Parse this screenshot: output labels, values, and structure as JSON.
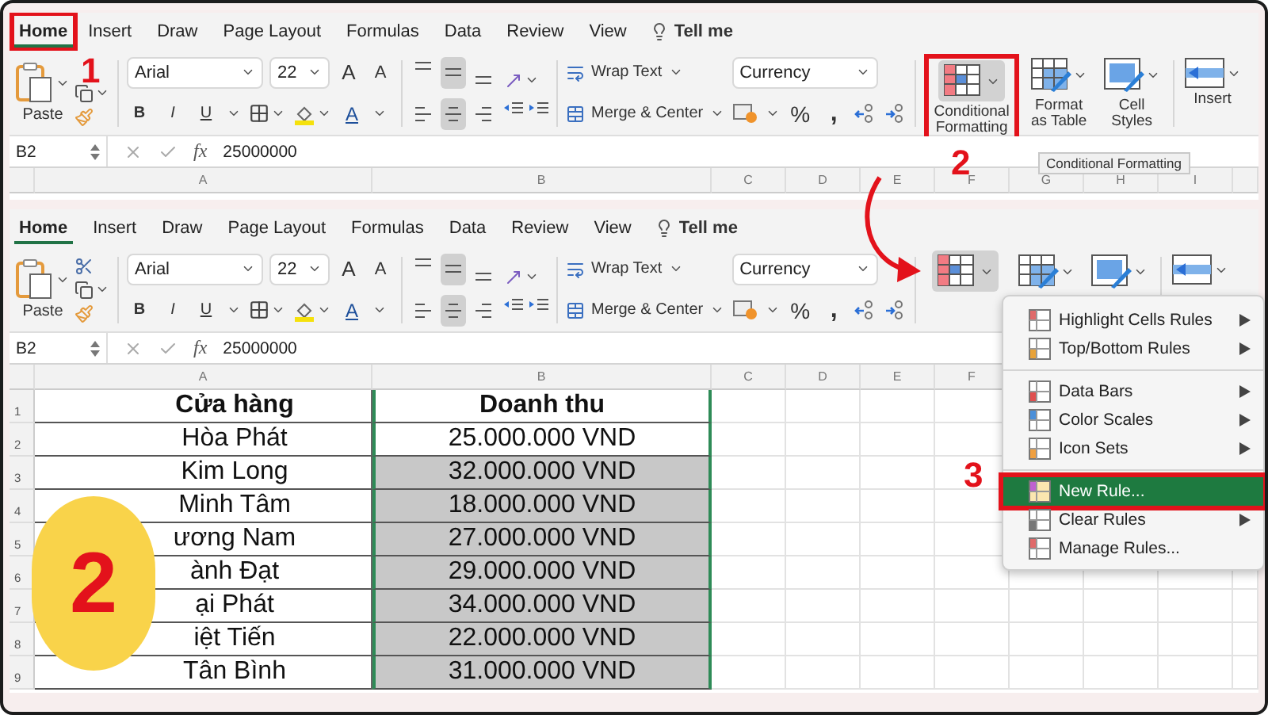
{
  "panels": [
    {
      "tabs": [
        {
          "label": "Home",
          "selected": true
        },
        {
          "label": "Insert",
          "selected": false
        },
        {
          "label": "Draw",
          "selected": false
        },
        {
          "label": "Page Layout",
          "selected": false
        },
        {
          "label": "Formulas",
          "selected": false
        },
        {
          "label": "Data",
          "selected": false
        },
        {
          "label": "Review",
          "selected": false
        },
        {
          "label": "View",
          "selected": false
        }
      ],
      "tell_me": "Tell me",
      "paste_label": "Paste",
      "font_name": "Arial",
      "font_size": "22",
      "font_grow": "A",
      "font_shrink": "A",
      "style_letters": [
        "B",
        "I",
        "U"
      ],
      "font_color_letter": "A",
      "wrap_text": "Wrap Text",
      "merge_center": "Merge & Center",
      "number_format": "Currency",
      "percent": "%",
      "comma": ",",
      "style_buttons": [
        {
          "label": "Conditional Formatting",
          "pressed": true
        },
        {
          "label": "Format as Table",
          "pressed": false
        },
        {
          "label": "Cell Styles",
          "pressed": false
        }
      ],
      "insert_label": "Insert",
      "name_box": "B2",
      "fx": "fx",
      "formula": "25000000",
      "columns": [
        "A",
        "B",
        "C",
        "D",
        "E",
        "F",
        "G",
        "H",
        "I"
      ]
    },
    {
      "tabs": [
        {
          "label": "Home",
          "selected": true
        },
        {
          "label": "Insert",
          "selected": false
        },
        {
          "label": "Draw",
          "selected": false
        },
        {
          "label": "Page Layout",
          "selected": false
        },
        {
          "label": "Formulas",
          "selected": false
        },
        {
          "label": "Data",
          "selected": false
        },
        {
          "label": "Review",
          "selected": false
        },
        {
          "label": "View",
          "selected": false
        }
      ],
      "tell_me": "Tell me",
      "paste_label": "Paste",
      "font_name": "Arial",
      "font_size": "22",
      "font_grow": "A",
      "font_shrink": "A",
      "style_letters": [
        "B",
        "I",
        "U"
      ],
      "font_color_letter": "A",
      "wrap_text": "Wrap Text",
      "merge_center": "Merge & Center",
      "number_format": "Currency",
      "percent": "%",
      "comma": ",",
      "style_buttons": [
        {
          "pressed": true
        },
        {
          "pressed": false
        },
        {
          "pressed": false
        }
      ],
      "name_box": "B2",
      "fx": "fx",
      "formula": "25000000",
      "columns": [
        "A",
        "B",
        "C",
        "D",
        "E",
        "F"
      ],
      "rows": [
        {
          "number": "1",
          "kind": "header",
          "store": "Cửa hàng",
          "revenue": "Doanh thu",
          "shaded": false
        },
        {
          "number": "2",
          "kind": "data",
          "store": "Hòa Phát",
          "revenue": "25.000.000 VND",
          "shaded": false
        },
        {
          "number": "3",
          "kind": "data",
          "store": "Kim Long",
          "revenue": "32.000.000 VND",
          "shaded": true
        },
        {
          "number": "4",
          "kind": "data",
          "store": "Minh Tâm",
          "revenue": "18.000.000 VND",
          "shaded": true
        },
        {
          "number": "5",
          "kind": "data",
          "store": "ương Nam",
          "revenue": "27.000.000 VND",
          "shaded": true
        },
        {
          "number": "6",
          "kind": "data",
          "store": "ành Đạt",
          "revenue": "29.000.000 VND",
          "shaded": true
        },
        {
          "number": "7",
          "kind": "data",
          "store": "ại Phát",
          "revenue": "34.000.000 VND",
          "shaded": true
        },
        {
          "number": "8",
          "kind": "data",
          "store": "iệt Tiến",
          "revenue": "22.000.000 VND",
          "shaded": true
        },
        {
          "number": "9",
          "kind": "data",
          "store": "Tân Bình",
          "revenue": "31.000.000 VND",
          "shaded": true
        }
      ],
      "menu": {
        "sections": [
          {
            "items": [
              {
                "label": "Highlight Cells Rules",
                "submenu": true,
                "selected": false
              },
              {
                "label": "Top/Bottom Rules",
                "submenu": true,
                "selected": false
              }
            ]
          },
          {
            "items": [
              {
                "label": "Data Bars",
                "submenu": true,
                "selected": false
              },
              {
                "label": "Color Scales",
                "submenu": true,
                "selected": false
              },
              {
                "label": "Icon Sets",
                "submenu": true,
                "selected": false
              }
            ]
          },
          {
            "items": [
              {
                "label": "New Rule...",
                "submenu": false,
                "selected": true
              },
              {
                "label": "Clear Rules",
                "submenu": true,
                "selected": false
              },
              {
                "label": "Manage Rules...",
                "submenu": false,
                "selected": false
              }
            ]
          }
        ]
      }
    }
  ],
  "tooltip": "Conditional Formatting",
  "steps": [
    {
      "label": "1"
    },
    {
      "label": "2"
    },
    {
      "label": "3"
    }
  ],
  "badge": {
    "label": "2"
  }
}
